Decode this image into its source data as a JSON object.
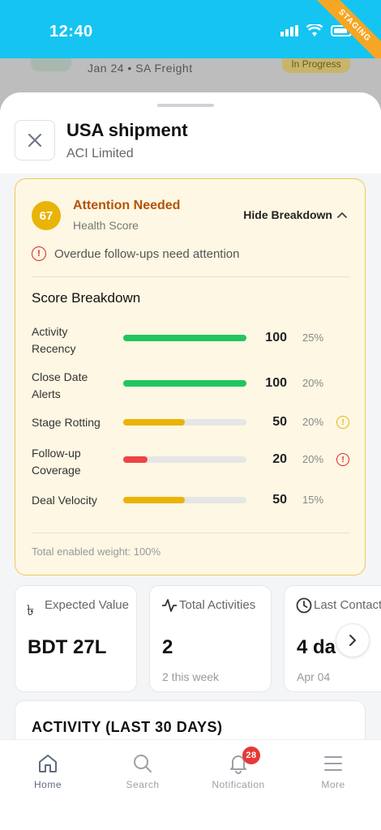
{
  "status_bar": {
    "time": "12:40",
    "ribbon": "STAGING"
  },
  "background_item": {
    "meta": "Jan 24 • SA Freight",
    "status": "In Progress"
  },
  "header": {
    "title": "USA shipment",
    "subtitle": "ACI Limited",
    "close_icon": "close-icon"
  },
  "health": {
    "score": "67",
    "status": "Attention Needed",
    "label": "Health Score",
    "toggle_label": "Hide Breakdown",
    "warning": "Overdue follow-ups need attention",
    "breakdown_title": "Score Breakdown",
    "total_weight": "Total enabled weight: 100%",
    "metrics": [
      {
        "label": "Activity Recency",
        "score": "100",
        "weight": "25%",
        "value": 100,
        "color": "#22c55e",
        "warn": ""
      },
      {
        "label": "Close Date Alerts",
        "score": "100",
        "weight": "20%",
        "value": 100,
        "color": "#22c55e",
        "warn": ""
      },
      {
        "label": "Stage Rotting",
        "score": "50",
        "weight": "20%",
        "value": 50,
        "color": "#eab308",
        "warn": "#eab308"
      },
      {
        "label": "Follow-up Coverage",
        "score": "20",
        "weight": "20%",
        "value": 20,
        "color": "#ef4444",
        "warn": "#dc2626"
      },
      {
        "label": "Deal Velocity",
        "score": "50",
        "weight": "15%",
        "value": 50,
        "color": "#eab308",
        "warn": ""
      }
    ]
  },
  "stats": [
    {
      "icon": "taka-icon",
      "label": "Expected Value",
      "value": "BDT 27L",
      "sub": ""
    },
    {
      "icon": "activity-icon",
      "label": "Total Activities",
      "value": "2",
      "sub": "2 this week"
    },
    {
      "icon": "clock-icon",
      "label": "Last Contact",
      "value": "4 da",
      "sub": "Apr 04"
    }
  ],
  "activity_title": "ACTIVITY (LAST 30 DAYS)",
  "nav": {
    "home": "Home",
    "search": "Search",
    "notification": "Notification",
    "notification_count": "28",
    "more": "More"
  },
  "colors": {
    "accent": "#16c4f1",
    "warning": "#eab308",
    "danger": "#ef4444",
    "success": "#22c55e"
  }
}
